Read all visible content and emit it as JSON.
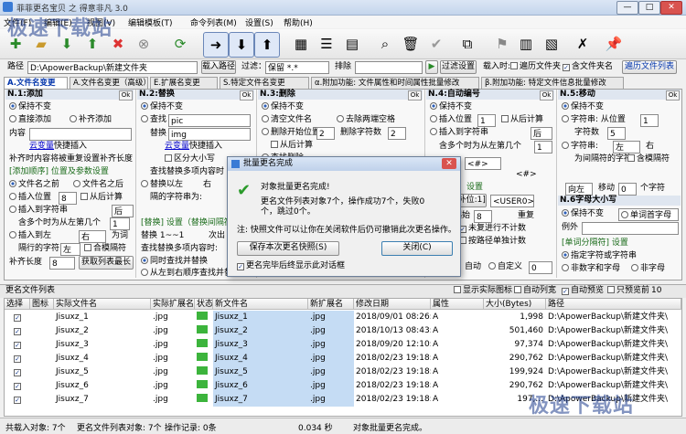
{
  "window": {
    "title": "菲菲更名宝贝 之 得意非凡 3.0",
    "min": "—",
    "max": "□",
    "close": "✕"
  },
  "watermark": "极速下载站",
  "menu": [
    "文件(F)",
    "编辑(E)",
    "视图(V)",
    "编辑模板(T)",
    "命令列表(M)",
    "设置(S)",
    "帮助(H)"
  ],
  "path": {
    "label": "路径",
    "value": "D:\\ApowerBackup\\新建文件夹",
    "load_btn": "载入路径",
    "filter_label": "过滤：",
    "filter_value": "保留 *.*",
    "exclude_label": "排除",
    "filter_btn": "过滤设置",
    "load_label": "载入时:",
    "opt1": "遍历文件夹",
    "opt2": "含文件夹名",
    "traverse_btn": "遍历文件列表"
  },
  "tabs": [
    "A.文件名变更",
    "A.文件名变更（高级）",
    "E.扩展名变更",
    "S.特定文件名变更",
    "α.附加功能: 文件属性和时间属性批量修改",
    "β.附加功能: 特定文件信息批量修改"
  ],
  "sec1": {
    "title": "N.1:添加",
    "ok": "Ok",
    "r1": "保持不变",
    "r2": "直接添加",
    "r3": "补齐添加",
    "content_label": "内容",
    "var_link": "云变量",
    "var_text": "快捷插入",
    "note": "补齐时内容将被重复设置补齐长度",
    "head2": "[添加顺序] 位置及参数设置",
    "pos1": "文件名之前",
    "pos2": "文件名之后",
    "insert_pos": "插入位置",
    "insert_val": "8",
    "from_right": "从后计算",
    "insert_to": "插入到字符串",
    "after": "后",
    "contain": "含多个时为从左第几个",
    "contain_val": "1",
    "insert_to2": "插入到左",
    "right": "右",
    "null_label": "为词",
    "sep_label": "隔行的字符",
    "sep_val": "左",
    "fill": "合模隔符",
    "pad_len": "补齐长度",
    "pad_val": "8",
    "pad_btn": "获取列表最长"
  },
  "sec2": {
    "title": "N.2:替换",
    "ok": "Ok",
    "r1": "保持不变",
    "find": "查找",
    "find_val": "pic",
    "replace": "替换",
    "replace_val": "img",
    "var_link": "云变量",
    "var_text": "快捷插入",
    "case": "区分大小写",
    "multi": "查找替换多项内容时",
    "keep": "替换以左",
    "right": "右",
    "sep": "隔的字符串为:",
    "head2": "[替换] 设置（替换间隔符）",
    "range": "替换 1~~1",
    "next": "次出",
    "multi2": "查找替换多项内容时:",
    "opt1": "同时查找并替换",
    "opt2": "从左到右顺序查找并替"
  },
  "sec3": {
    "title": "N.3:删除",
    "ok": "Ok",
    "r1": "保持不变",
    "c1": "清空文件名",
    "c2": "去除两端空格",
    "c3": "删除开始位置",
    "c3v": "2",
    "c4": "删除字符数",
    "c4v": "2",
    "c5": "从后计算",
    "c6": "查找删除"
  },
  "sec4": {
    "title": "N.4:自动编号",
    "ok": "Ok",
    "r1": "保持不变",
    "r2": "插入位置",
    "r2v": "1",
    "c1": "从后计算",
    "r3": "插入到字符串",
    "after": "后",
    "contain": "含多个时为从左第几个",
    "contain_val": "1",
    "head2": "设置",
    "pattern": "<#>",
    "fill": "[补位:1]",
    "fill_val": "<USER0>",
    "start": "起始",
    "start_val": "8",
    "repeat": "重复",
    "skip": "未复进行不计数",
    "step": "按路径单独计数",
    "auto": "自动",
    "custom": "自定义",
    "custom_val": "0"
  },
  "sec5": {
    "title": "N.5:移动",
    "ok": "Ok",
    "r1": "保持不变",
    "r2": "字符串: 从位置",
    "r2v": "1",
    "count": "字符数",
    "count_val": "5",
    "r3": "字符串:",
    "left": "左",
    "right": "右",
    "r4": "为间隔符的字符",
    "fill": "含模隔符",
    "dir": "向左",
    "move": "移动",
    "move_val": "0",
    "char": "个字符",
    "head2": "N.6字母大小写",
    "upper": "保持不变",
    "case_sel": "单词首字母",
    "example": "例外",
    "head3": "[单词分隔符] 设置",
    "split1": "指定字符或字符串",
    "split2": "非数字和字母",
    "split3": "非字母"
  },
  "dialog": {
    "title": "批量更名完成",
    "msg": "对象批量更名完成!",
    "detail": "更名文件列表对象7个，操作成功7个，失败0个，跳过0个。",
    "note": "注: 快照文件可以让你在关闭软件后仍可撤销此次更名操作。",
    "save_btn": "保存本次更名快照(S)",
    "close_btn": "关闭(C)",
    "chk": "更名完毕后终显示此对话框"
  },
  "list": {
    "title": "更名文件列表",
    "show_icon": "显示实际图标",
    "auto_width": "自动列宽",
    "auto_preview": "自动预览",
    "only_preview": "只预览前",
    "preview_n": "10"
  },
  "columns": [
    "选择",
    "图标",
    "实际文件名",
    "实际扩展名",
    "状态",
    "新文件名",
    "新扩展名",
    "修改日期",
    "属性",
    "大小(Bytes)",
    "路径"
  ],
  "rows": [
    {
      "name": "Jisuxz_1",
      "ext": ".jpg",
      "new": "Jisuxz_1",
      "new_ext": ".jpg",
      "date": "2018/09/01 08:26:...",
      "attr": "A",
      "size": "1,998",
      "path": "D:\\ApowerBackup\\新建文件夹\\"
    },
    {
      "name": "Jisuxz_2",
      "ext": ".jpg",
      "new": "Jisuxz_2",
      "new_ext": ".jpg",
      "date": "2018/10/13 08:43:...",
      "attr": "A",
      "size": "501,460",
      "path": "D:\\ApowerBackup\\新建文件夹\\"
    },
    {
      "name": "Jisuxz_3",
      "ext": ".jpg",
      "new": "Jisuxz_3",
      "new_ext": ".jpg",
      "date": "2018/09/20 12:10:...",
      "attr": "A",
      "size": "97,374",
      "path": "D:\\ApowerBackup\\新建文件夹\\"
    },
    {
      "name": "Jisuxz_4",
      "ext": ".jpg",
      "new": "Jisuxz_4",
      "new_ext": ".jpg",
      "date": "2018/02/23 19:18:...",
      "attr": "A",
      "size": "290,762",
      "path": "D:\\ApowerBackup\\新建文件夹\\"
    },
    {
      "name": "Jisuxz_5",
      "ext": ".jpg",
      "new": "Jisuxz_5",
      "new_ext": ".jpg",
      "date": "2018/02/23 19:18:...",
      "attr": "A",
      "size": "199,924",
      "path": "D:\\ApowerBackup\\新建文件夹\\"
    },
    {
      "name": "Jisuxz_6",
      "ext": ".jpg",
      "new": "Jisuxz_6",
      "new_ext": ".jpg",
      "date": "2018/02/23 19:18:...",
      "attr": "A",
      "size": "290,762",
      "path": "D:\\ApowerBackup\\新建文件夹\\"
    },
    {
      "name": "Jisuxz_7",
      "ext": ".jpg",
      "new": "Jisuxz_7",
      "new_ext": ".jpg",
      "date": "2018/02/23 19:18:...",
      "attr": "A",
      "size": "197,...",
      "path": "D:\\ApowerBackup\\新建文件夹\\"
    }
  ],
  "status": {
    "s1": "共载入对象: 7个",
    "s2": "更名文件列表对象: 7个",
    "s3": "操作记录: 0条",
    "s4": "0.034 秒",
    "s5": "对象批量更名完成。"
  }
}
